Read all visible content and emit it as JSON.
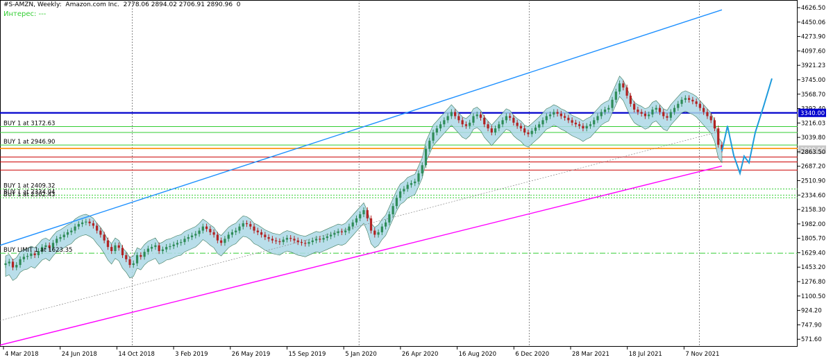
{
  "header": {
    "info": "#S-AMZN, Weekly:  Amazon.com Inc.  2778.06 2894.02 2706.91 2890.96  0",
    "interest": "Интерес: ---"
  },
  "colors": {
    "candle_up": "#2e8b57",
    "candle_down": "#b22222",
    "cloud_up": "#add8e6",
    "cloud_down": "#f9c8a8",
    "upper_channel": "#1e90ff",
    "lower_channel": "#ff00ff",
    "resistance": "#0000cd",
    "support_red": "#cc0000",
    "support_orange": "#ff8c00",
    "level_green": "#32cd32",
    "projection": "#1e9bdc",
    "current_price_bg": "#c8c8c8",
    "resistance_label_bg": "#0000cd"
  },
  "chart_data": {
    "type": "candlestick",
    "symbol": "#S-AMZN",
    "timeframe": "Weekly",
    "ylim": [
      480,
      4720
    ],
    "y_ticks": [
      "4626.50",
      "4450.06",
      "4273.90",
      "4097.60",
      "3921.23",
      "3745.00",
      "3568.70",
      "3392.40",
      "3216.03",
      "3039.80",
      "2863.50",
      "2687.20",
      "2510.90",
      "2334.60",
      "2158.30",
      "1982.00",
      "1805.70",
      "1629.40",
      "1453.20",
      "1276.80",
      "1100.50",
      "924.20",
      "747.90",
      "571.60"
    ],
    "x_ticks": [
      "4 Mar 2018",
      "24 Jun 2018",
      "14 Oct 2018",
      "3 Feb 2019",
      "26 May 2019",
      "15 Sep 2019",
      "5 Jan 2020",
      "26 Apr 2020",
      "16 Aug 2020",
      "6 Dec 2020",
      "28 Mar 2021",
      "18 Jul 2021",
      "7 Nov 2021"
    ],
    "closes": [
      1500,
      1520,
      1450,
      1480,
      1550,
      1580,
      1590,
      1620,
      1600,
      1650,
      1700,
      1720,
      1690,
      1750,
      1800,
      1820,
      1850,
      1880,
      1900,
      1950,
      1980,
      2000,
      2010,
      1990,
      1960,
      1900,
      1850,
      1780,
      1700,
      1650,
      1720,
      1690,
      1600,
      1550,
      1480,
      1500,
      1600,
      1580,
      1640,
      1680,
      1700,
      1720,
      1650,
      1670,
      1700,
      1710,
      1730,
      1750,
      1760,
      1800,
      1820,
      1840,
      1860,
      1900,
      1950,
      1920,
      1880,
      1850,
      1780,
      1750,
      1800,
      1850,
      1880,
      1900,
      1950,
      1990,
      1980,
      1950,
      1900,
      1880,
      1850,
      1820,
      1800,
      1780,
      1770,
      1760,
      1790,
      1810,
      1800,
      1780,
      1760,
      1750,
      1740,
      1760,
      1780,
      1800,
      1790,
      1810,
      1830,
      1850,
      1870,
      1890,
      1880,
      1900,
      1950,
      2000,
      2050,
      2100,
      2150,
      2050,
      1900,
      1850,
      1880,
      1950,
      2000,
      2100,
      2200,
      2300,
      2380,
      2410,
      2460,
      2480,
      2500,
      2600,
      2700,
      2900,
      3000,
      3100,
      3150,
      3200,
      3250,
      3300,
      3350,
      3300,
      3250,
      3200,
      3180,
      3220,
      3300,
      3320,
      3280,
      3200,
      3150,
      3100,
      3150,
      3200,
      3250,
      3300,
      3280,
      3220,
      3180,
      3150,
      3100,
      3080,
      3120,
      3160,
      3200,
      3250,
      3300,
      3320,
      3350,
      3330,
      3300,
      3280,
      3250,
      3220,
      3200,
      3180,
      3150,
      3180,
      3200,
      3250,
      3300,
      3350,
      3380,
      3400,
      3500,
      3600,
      3700,
      3650,
      3550,
      3450,
      3380,
      3350,
      3330,
      3300,
      3320,
      3380,
      3400,
      3350,
      3300,
      3280,
      3350,
      3400,
      3450,
      3500,
      3520,
      3500,
      3480,
      3450,
      3400,
      3350,
      3300,
      3250,
      3150,
      2950,
      2890.96
    ],
    "levels": [
      {
        "label": "",
        "value": 3340.0,
        "color": "#0000cd",
        "style": "solid",
        "price_label": "3340.00"
      },
      {
        "label": "BUY 1 at 3172.63",
        "value": 3172.63,
        "color": "#32cd32",
        "style": "solid"
      },
      {
        "label": "",
        "value": 3100.0,
        "color": "#32cd32",
        "style": "solid"
      },
      {
        "label": "BUY 1 at 2946.90",
        "value": 2946.9,
        "color": "#32cd32",
        "style": "solid"
      },
      {
        "label": "",
        "value": 2905.0,
        "color": "#ff8c00",
        "style": "solid"
      },
      {
        "label": "",
        "value": 2800.0,
        "color": "#cc0000",
        "style": "solid"
      },
      {
        "label": "",
        "value": 2740.0,
        "color": "#cc0000",
        "style": "solid"
      },
      {
        "label": "",
        "value": 2640.0,
        "color": "#cc0000",
        "style": "solid"
      },
      {
        "label": "BUY 1 at 2409.32",
        "value": 2409.32,
        "color": "#32cd32",
        "style": "dotted"
      },
      {
        "label": "BUY 1 at 2334.04",
        "value": 2334.04,
        "color": "#32cd32",
        "style": "dotted"
      },
      {
        "label": "BUY 1 at 2302.43",
        "value": 2302.43,
        "color": "#32cd32",
        "style": "dotted"
      },
      {
        "label": "BUY LIMIT 1 at 1623.35",
        "value": 1623.35,
        "color": "#32cd32",
        "style": "dashdot"
      }
    ],
    "current_price": "2890.96",
    "upper_channel": {
      "from_price": 1720,
      "to_price": 4600
    },
    "lower_channel": {
      "from_price": 500,
      "to_price": 2690
    },
    "mid_channel": {
      "from_price": 800,
      "to_price": 3120
    },
    "projection": [
      2870,
      3180,
      2820,
      2600,
      2810,
      2730,
      3100,
      3420,
      3760
    ]
  }
}
